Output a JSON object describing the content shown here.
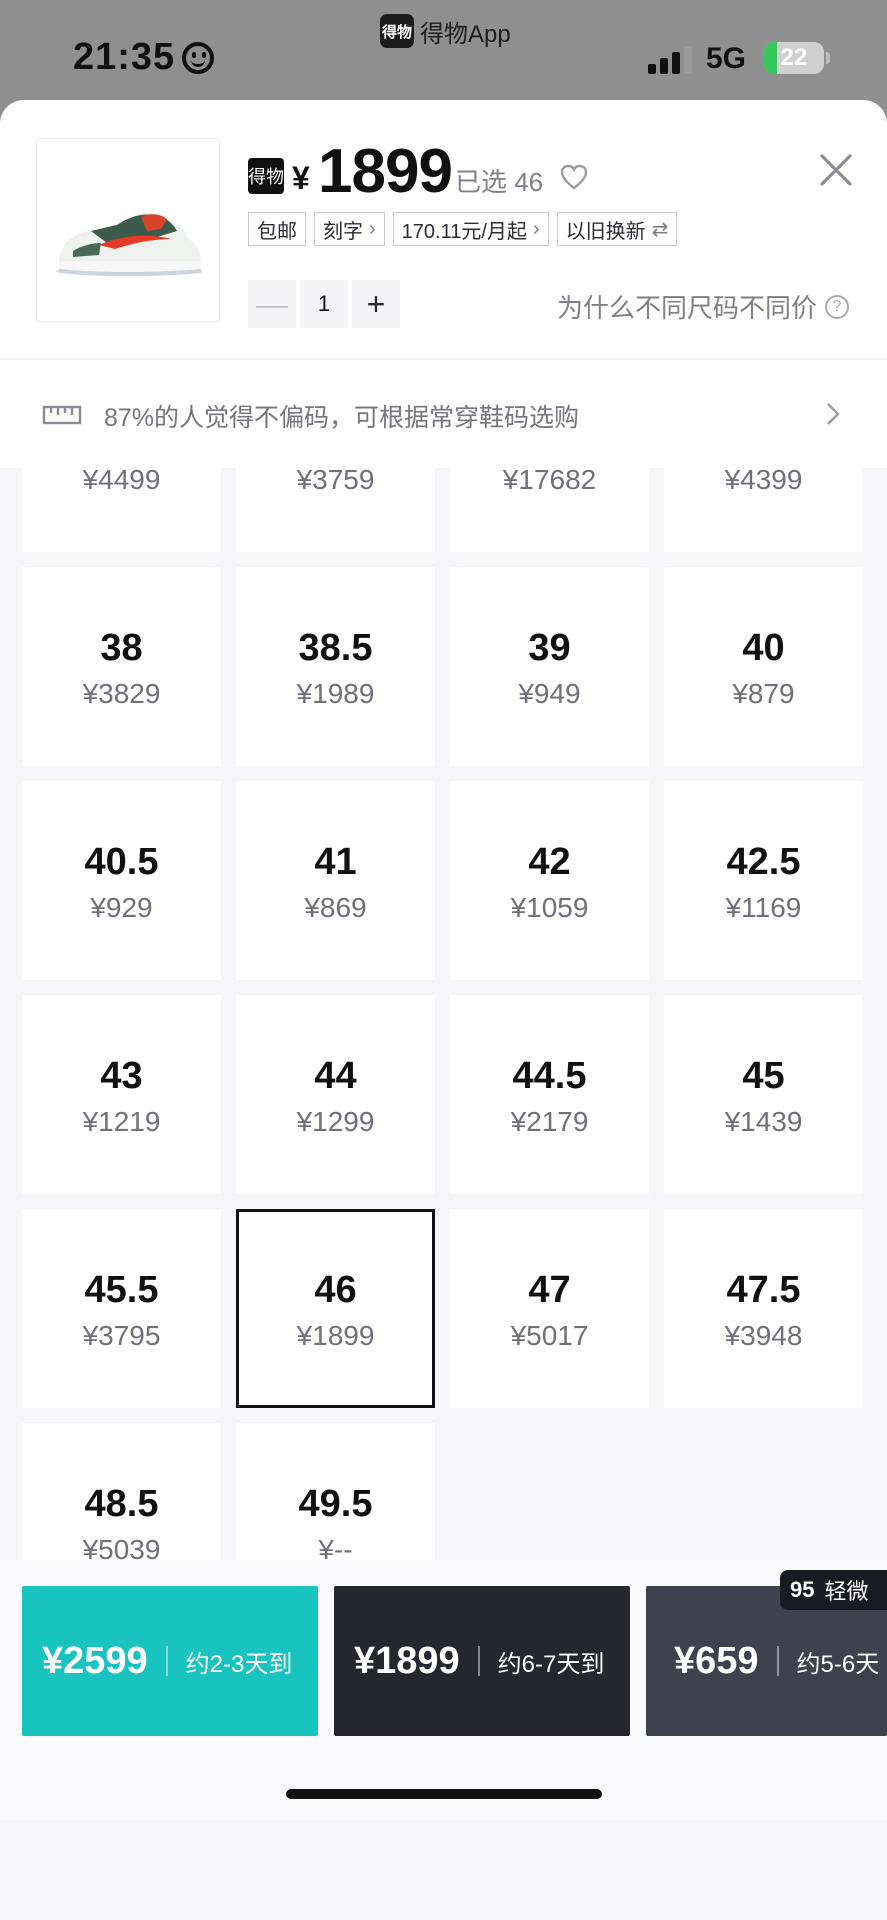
{
  "status_bar": {
    "time": "21:35",
    "app_name": "得物App",
    "app_logo_text": "得物",
    "network": "5G",
    "battery": "22",
    "battery_level": 0.22
  },
  "product": {
    "brand_badge": "得物",
    "currency": "¥",
    "price": "1899",
    "selected": "已选 46",
    "tags": [
      "包邮",
      "刻字",
      "170.11元/月起",
      "以旧换新"
    ],
    "quantity": "1",
    "why_price": "为什么不同尺码不同价"
  },
  "size_tip": "87%的人觉得不偏码，可根据常穿鞋码选购",
  "sizes": [
    {
      "size": "",
      "price": "¥4499"
    },
    {
      "size": "",
      "price": "¥3759"
    },
    {
      "size": "",
      "price": "¥17682"
    },
    {
      "size": "",
      "price": "¥4399"
    },
    {
      "size": "38",
      "price": "¥3829"
    },
    {
      "size": "38.5",
      "price": "¥1989"
    },
    {
      "size": "39",
      "price": "¥949"
    },
    {
      "size": "40",
      "price": "¥879"
    },
    {
      "size": "40.5",
      "price": "¥929"
    },
    {
      "size": "41",
      "price": "¥869"
    },
    {
      "size": "42",
      "price": "¥1059"
    },
    {
      "size": "42.5",
      "price": "¥1169"
    },
    {
      "size": "43",
      "price": "¥1219"
    },
    {
      "size": "44",
      "price": "¥1299"
    },
    {
      "size": "44.5",
      "price": "¥2179"
    },
    {
      "size": "45",
      "price": "¥1439"
    },
    {
      "size": "45.5",
      "price": "¥3795"
    },
    {
      "size": "46",
      "price": "¥1899",
      "selected": true
    },
    {
      "size": "47",
      "price": "¥5017"
    },
    {
      "size": "47.5",
      "price": "¥3948"
    },
    {
      "size": "48.5",
      "price": "¥5039"
    },
    {
      "size": "49.5",
      "price": "¥--"
    }
  ],
  "purchase_options": [
    {
      "price": "¥2599",
      "eta": "约2-3天到",
      "color": "#18c3c0"
    },
    {
      "price": "¥1899",
      "eta": "约6-7天到",
      "color": "#26262e"
    },
    {
      "price": "¥659",
      "eta": "约5-6天",
      "color": "#3f414e",
      "badge_num": "95",
      "badge_text": "轻微"
    }
  ]
}
